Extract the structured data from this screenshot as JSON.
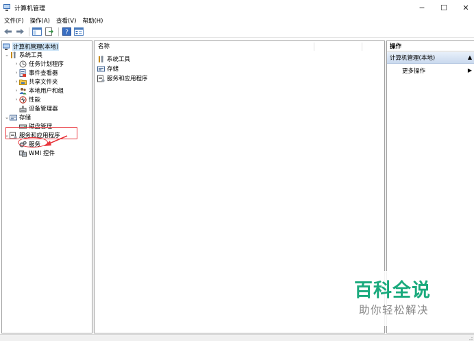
{
  "window": {
    "title": "计算机管理",
    "minimize_glyph": "−",
    "maximize_glyph": "☐",
    "close_glyph": "✕"
  },
  "menu": [
    "文件(F)",
    "操作(A)",
    "查看(V)",
    "帮助(H)"
  ],
  "toolbar": {
    "icons": [
      "back-arrow-icon",
      "forward-arrow-icon",
      "show-hide-console-tree-icon",
      "export-list-icon",
      "help-icon",
      "properties-icon"
    ]
  },
  "tree": {
    "root": "计算机管理(本地)",
    "system_tools": "系统工具",
    "task_scheduler": "任务计划程序",
    "event_viewer": "事件查看器",
    "shared_folders": "共享文件夹",
    "local_users": "本地用户和组",
    "performance": "性能",
    "device_manager": "设备管理器",
    "storage": "存储",
    "disk_management": "磁盘管理",
    "services_apps": "服务和应用程序",
    "services": "服务",
    "wmi_control": "WMI 控件"
  },
  "list": {
    "column_name": "名称",
    "rows": [
      "系统工具",
      "存储",
      "服务和应用程序"
    ]
  },
  "actions": {
    "header": "操作",
    "section": "计算机管理(本地)",
    "more": "更多操作"
  },
  "watermark": {
    "title": "百科全说",
    "subtitle": "助你轻松解决"
  },
  "colors": {
    "selection": "#cce4f7",
    "annotation": "#e8343b",
    "watermark_green": "#1aaa7d"
  }
}
